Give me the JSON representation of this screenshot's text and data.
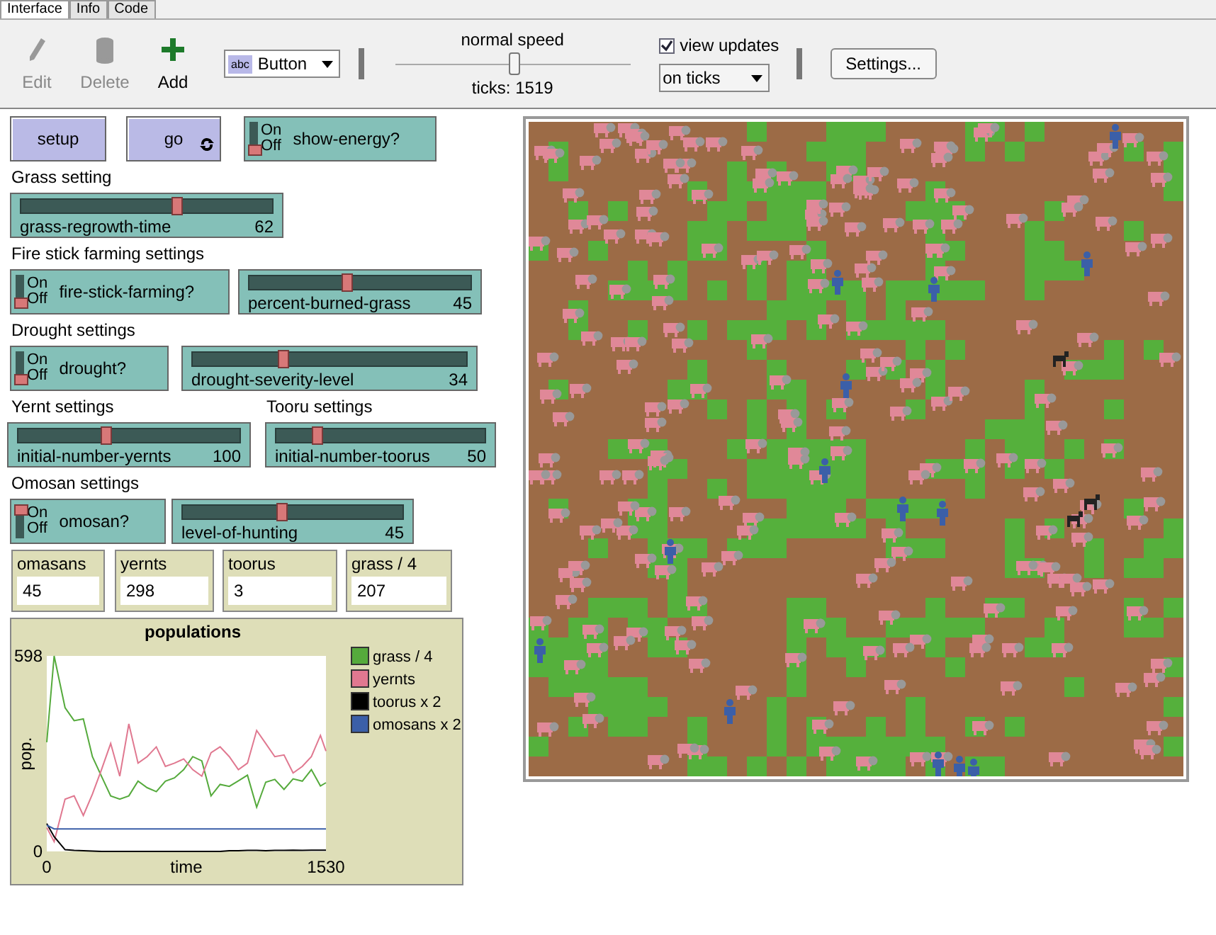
{
  "tabs": [
    {
      "label": "Interface",
      "selected": true
    },
    {
      "label": "Info",
      "selected": false
    },
    {
      "label": "Code",
      "selected": false
    }
  ],
  "toolbar": {
    "tools": [
      {
        "kind": "edit",
        "label": "Edit",
        "disabled": true
      },
      {
        "kind": "delete",
        "label": "Delete",
        "disabled": true
      },
      {
        "kind": "add",
        "label": "Add",
        "disabled": false
      }
    ],
    "widget_type": {
      "icon_text": "abc",
      "label": "Button"
    },
    "speed": {
      "label": "normal speed",
      "level": 0.5,
      "ticks": "ticks: 1519"
    },
    "view_updates": {
      "label": "view updates",
      "checked": true,
      "mode": "on ticks"
    },
    "settings_button": "Settings..."
  },
  "rows": [
    {
      "items": [
        {
          "kind": "button",
          "label": "setup",
          "forever": false
        },
        {
          "kind": "button",
          "label": "go",
          "forever": true
        },
        {
          "kind": "switch",
          "label": "show-energy?",
          "on": false,
          "on_text": "On",
          "off_text": "Off"
        }
      ]
    },
    {
      "items": [
        {
          "kind": "label",
          "text": "Grass setting"
        }
      ]
    },
    {
      "items": [
        {
          "kind": "slider",
          "label": "grass-regrowth-time",
          "value": "62",
          "level": 0.62
        }
      ]
    },
    {
      "items": [
        {
          "kind": "label",
          "text": "Fire stick farming settings"
        }
      ]
    },
    {
      "items": [
        {
          "kind": "switch",
          "label": "fire-stick-farming?",
          "on": false,
          "on_text": "On",
          "off_text": "Off"
        },
        {
          "kind": "slider",
          "label": "percent-burned-grass",
          "value": "45",
          "level": 0.44
        }
      ]
    },
    {
      "items": [
        {
          "kind": "label",
          "text": "Drought settings"
        }
      ]
    },
    {
      "items": [
        {
          "kind": "switch",
          "label": "drought?",
          "on": false,
          "on_text": "On",
          "off_text": "Off"
        },
        {
          "kind": "slider",
          "label": "drought-severity-level",
          "value": "34",
          "level": 0.33
        }
      ]
    },
    {
      "items": [
        {
          "kind": "label",
          "text": "Yernt settings"
        },
        {
          "kind": "label",
          "text": "Tooru settings"
        }
      ]
    },
    {
      "items": [
        {
          "kind": "slider",
          "label": "initial-number-yernts",
          "value": "100",
          "level": 0.4
        },
        {
          "kind": "slider",
          "label": "initial-number-toorus",
          "value": "50",
          "level": 0.2
        }
      ]
    },
    {
      "items": [
        {
          "kind": "label",
          "text": "Omosan settings"
        }
      ]
    },
    {
      "items": [
        {
          "kind": "switch",
          "label": "omosan?",
          "on": true,
          "on_text": "On",
          "off_text": "Off"
        },
        {
          "kind": "slider",
          "label": "level-of-hunting",
          "value": "45",
          "level": 0.45
        }
      ]
    },
    {
      "items": [
        {
          "kind": "monitor",
          "label": "omasans",
          "value": "45"
        },
        {
          "kind": "monitor",
          "label": "yernts",
          "value": "298"
        },
        {
          "kind": "monitor",
          "label": "toorus",
          "value": "3"
        },
        {
          "kind": "monitor",
          "label": "grass / 4",
          "value": "207"
        }
      ]
    },
    {
      "items": [
        {
          "kind": "plot",
          "chart_data": {
            "type": "line",
            "legend": true,
            "title": "populations",
            "xlabel": "time",
            "ylabel": "pop.",
            "xlim": [
              0,
              1530
            ],
            "ylim": [
              0,
              598
            ],
            "xticks": [
              0,
              1530
            ],
            "yticks": [
              0,
              598
            ],
            "x": [
              0,
              40,
              100,
              150,
              200,
              250,
              300,
              350,
              400,
              450,
              500,
              550,
              600,
              650,
              700,
              750,
              800,
              850,
              900,
              950,
              1000,
              1050,
              1100,
              1150,
              1200,
              1250,
              1300,
              1350,
              1400,
              1450,
              1500,
              1530
            ],
            "series": [
              {
                "name": "grass / 4",
                "color": "#55aa3c",
                "values": [
                  334,
                  598,
                  440,
                  400,
                  405,
                  290,
                  230,
                  170,
                  160,
                  170,
                  215,
                  195,
                  183,
                  215,
                  225,
                  250,
                  290,
                  277,
                  170,
                  205,
                  199,
                  216,
                  233,
                  135,
                  212,
                  220,
                  190,
                  222,
                  215,
                  250,
                  200,
                  210
                ]
              },
              {
                "name": "yernts",
                "color": "#e07890",
                "values": [
                  73,
                  30,
                  160,
                  170,
                  110,
                  175,
                  250,
                  330,
                  230,
                  390,
                  270,
                  290,
                  320,
                  260,
                  270,
                  283,
                  250,
                  230,
                  302,
                  320,
                  290,
                  250,
                  270,
                  370,
                  330,
                  290,
                  295,
                  240,
                  260,
                  290,
                  355,
                  307
                ]
              },
              {
                "name": "toorus x 2",
                "color": "#000000",
                "values": [
                  85,
                  45,
                  5,
                  3,
                  2,
                  1,
                  0,
                  0,
                  0,
                  0,
                  0,
                  0,
                  0,
                  0,
                  0,
                  0,
                  0,
                  0,
                  0,
                  0,
                  2,
                  2,
                  3,
                  3,
                  2,
                  3,
                  3,
                  4,
                  3,
                  4,
                  4,
                  4
                ]
              },
              {
                "name": "omosans x 2",
                "color": "#3b5fa8",
                "values": [
                  80,
                  69,
                  69,
                  69,
                  69,
                  69,
                  69,
                  69,
                  69,
                  69,
                  69,
                  69,
                  69,
                  69,
                  69,
                  69,
                  69,
                  69,
                  69,
                  69,
                  69,
                  69,
                  69,
                  69,
                  69,
                  69,
                  69,
                  69,
                  69,
                  69,
                  69,
                  69
                ]
              }
            ]
          }
        }
      ]
    }
  ]
}
